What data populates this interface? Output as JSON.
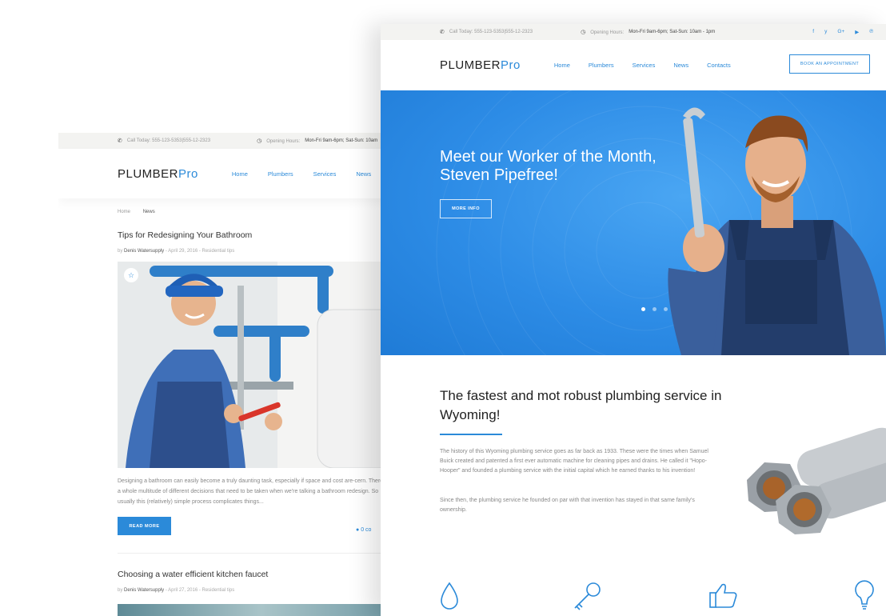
{
  "back_page": {
    "topbar": {
      "phone_text": "Call Today: 555-123-5353|555-12-2323",
      "hours_label": "Opening Hours:",
      "hours_value": "Mon-Fri 9am-6pm; Sat-Sun: 10am"
    },
    "logo": {
      "main": "PLUMBER",
      "accent": "Pro"
    },
    "nav": [
      "Home",
      "Plumbers",
      "Services",
      "News",
      "C"
    ],
    "breadcrumb": {
      "home": "Home",
      "current": "News"
    },
    "post1": {
      "title": "Tips for Redesigning Your Bathroom",
      "meta_by": "by ",
      "author": "Denis Watersupply",
      "meta_rest": " - April 29, 2016 - Residential tips",
      "excerpt": "Designing a bathroom can easily become a truly daunting task, especially if space and cost are-cern. There's a whole multitude of different decisions that need to be taken when we're talking a bathroom redesign. So usually this (relatively) simple process complicates things...",
      "read_more": "READ MORE",
      "comments": "0 co"
    },
    "post2": {
      "title": "Choosing a water efficient kitchen faucet",
      "meta_by": "by ",
      "author": "Denis Watersupply",
      "meta_rest": " - April 27, 2016 - Residential tips"
    }
  },
  "front_page": {
    "topbar": {
      "phone_text": "Call Today: 555-123-5353|555-12-2323",
      "hours_label": "Opening Hours:",
      "hours_value": "Mon-Fri 9am-6pm; Sat-Sun: 10am - 1pm"
    },
    "social_icons": [
      "facebook-icon",
      "twitter-icon",
      "google-plus-icon",
      "youtube-icon",
      "pinterest-icon"
    ],
    "social_glyphs": [
      "f",
      "y",
      "G+",
      "▶",
      "℗"
    ],
    "logo": {
      "main": "PLUMBER",
      "accent": "Pro"
    },
    "nav": [
      "Home",
      "Plumbers",
      "Services",
      "News",
      "Contacts"
    ],
    "appointment_button": "BOOK AN APPOINTMENT",
    "hero": {
      "title": "Meet our Worker of the Month, Steven Pipefree!",
      "button": "MORE INFO",
      "slides": 3,
      "active_slide": 1
    },
    "section": {
      "heading": "The fastest and mot robust plumbing service in Wyoming!",
      "para1": "The history of this Wyoming plumbing service goes as far back as 1933. These were the times when Samuel Buick created and patented a first ever automatic machine for cleaning pipes and drains. He called it \"Hopo-Hooper\" and founded a plumbing service with the initial capital which he earned thanks to his invention!",
      "para2": "Since then, the plumbing service he founded on par with that invention has stayed in that same family's ownership."
    },
    "feature_icons": [
      "water-drop-icon",
      "key-icon",
      "thumbs-up-icon",
      "lightbulb-icon"
    ]
  },
  "colors": {
    "accent": "#2b8ad9",
    "hero_bg": "#2d8ce6",
    "topbar_bg": "#f3f3f1"
  }
}
